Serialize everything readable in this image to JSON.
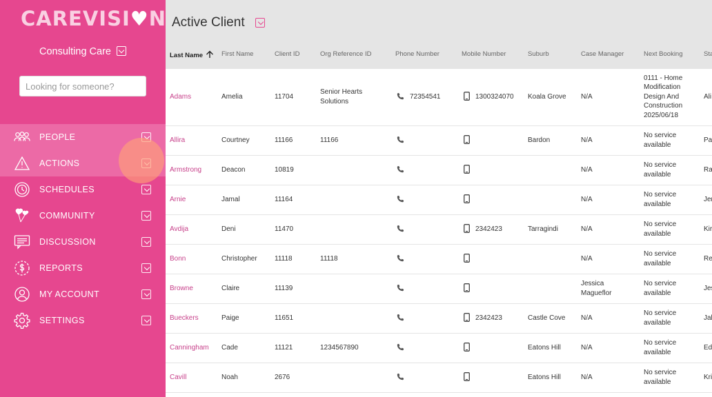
{
  "brand": {
    "logo_text_a": "CAREVISI",
    "logo_heart": "♥",
    "logo_text_b": "N",
    "accent": "#e6478f",
    "link_color": "#c7408a"
  },
  "sidebar": {
    "org_name": "Consulting Care",
    "search_placeholder": "Looking for someone?",
    "items": [
      {
        "label": "PEOPLE",
        "icon": "people-icon"
      },
      {
        "label": "ACTIONS",
        "icon": "warning-icon"
      },
      {
        "label": "SCHEDULES",
        "icon": "clock-icon"
      },
      {
        "label": "COMMUNITY",
        "icon": "heart-balloons-icon"
      },
      {
        "label": "DISCUSSION",
        "icon": "chat-icon"
      },
      {
        "label": "REPORTS",
        "icon": "dollar-icon"
      },
      {
        "label": "MY ACCOUNT",
        "icon": "user-icon"
      },
      {
        "label": "SETTINGS",
        "icon": "gear-icon"
      }
    ]
  },
  "main": {
    "title": "Active Client",
    "columns": [
      "Last Name",
      "First Name",
      "Client ID",
      "Org Reference ID",
      "Phone Number",
      "Mobile Number",
      "Suburb",
      "Case Manager",
      "Next Booking",
      "Sta"
    ],
    "rows": [
      {
        "last": "Adams",
        "first": "Amelia",
        "id": "11704",
        "org_ref": "Senior Hearts Solutions",
        "phone": "72354541",
        "mobile": "1300324070",
        "suburb": "Koala Grove",
        "case_manager": "N/A",
        "next_booking": "0111 - Home Modification Design And Construction 2025/06/18",
        "sta": "Ali"
      },
      {
        "last": "Allira",
        "first": "Courtney",
        "id": "11166",
        "org_ref": "11166",
        "phone": "",
        "mobile": "",
        "suburb": "Bardon",
        "case_manager": "N/A",
        "next_booking": "No service available",
        "sta": "Pa"
      },
      {
        "last": "Armstrong",
        "first": "Deacon",
        "id": "10819",
        "org_ref": "",
        "phone": "",
        "mobile": "",
        "suburb": "",
        "case_manager": "N/A",
        "next_booking": "No service available",
        "sta": "Ra"
      },
      {
        "last": "Arnie",
        "first": "Jamal",
        "id": "11164",
        "org_ref": "",
        "phone": "",
        "mobile": "",
        "suburb": "",
        "case_manager": "N/A",
        "next_booking": "No service available",
        "sta": "Jer"
      },
      {
        "last": "Avdija",
        "first": "Deni",
        "id": "11470",
        "org_ref": "",
        "phone": "",
        "mobile": "2342423",
        "suburb": "Tarragindi",
        "case_manager": "N/A",
        "next_booking": "No service available",
        "sta": "Kir"
      },
      {
        "last": "Bonn",
        "first": "Christopher",
        "id": "11118",
        "org_ref": "11118",
        "phone": "",
        "mobile": "",
        "suburb": "",
        "case_manager": "N/A",
        "next_booking": "No service available",
        "sta": "Re"
      },
      {
        "last": "Browne",
        "first": "Claire",
        "id": "11139",
        "org_ref": "",
        "phone": "",
        "mobile": "",
        "suburb": "",
        "case_manager": "Jessica Magueflor",
        "next_booking": "No service available",
        "sta": "Jes"
      },
      {
        "last": "Bueckers",
        "first": "Paige",
        "id": "11651",
        "org_ref": "",
        "phone": "",
        "mobile": "2342423",
        "suburb": "Castle Cove",
        "case_manager": "N/A",
        "next_booking": "No service available",
        "sta": "Jal"
      },
      {
        "last": "Canningham",
        "first": "Cade",
        "id": "11121",
        "org_ref": "1234567890",
        "phone": "",
        "mobile": "",
        "suburb": "Eatons Hill",
        "case_manager": "N/A",
        "next_booking": "No service available",
        "sta": "Ed"
      },
      {
        "last": "Cavill",
        "first": "Noah",
        "id": "2676",
        "org_ref": "",
        "phone": "",
        "mobile": "",
        "suburb": "Eatons Hill",
        "case_manager": "N/A",
        "next_booking": "No service available",
        "sta": "Kri"
      }
    ]
  }
}
